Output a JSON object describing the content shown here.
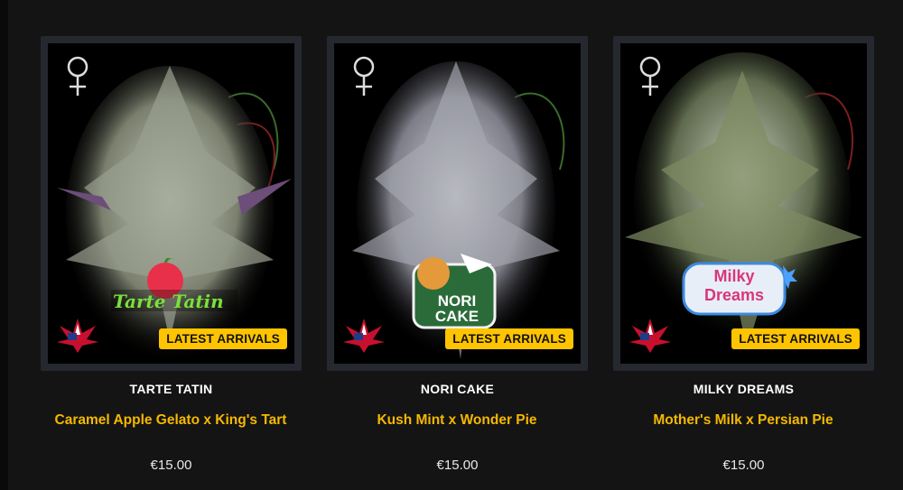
{
  "products": [
    {
      "name": "TARTE TATIN",
      "lineage": "Caramel Apple Gelato x King's Tart",
      "price": "€15.00",
      "badge": "LATEST ARRIVALS",
      "logo_text": "Tarte Tatin",
      "sex_icon": "female-symbol-icon",
      "flag_icon": "usa-flag-leaf-icon",
      "plant_color": "#a9b2a0"
    },
    {
      "name": "NORI CAKE",
      "lineage": "Kush Mint x Wonder Pie",
      "price": "€15.00",
      "badge": "LATEST ARRIVALS",
      "logo_text": "NORI CAKE",
      "sex_icon": "female-symbol-icon",
      "flag_icon": "usa-flag-leaf-icon",
      "plant_color": "#b7b8bf"
    },
    {
      "name": "MILKY DREAMS",
      "lineage": "Mother's Milk x Persian Pie",
      "price": "€15.00",
      "badge": "LATEST ARRIVALS",
      "logo_text": "Milky Dreams",
      "sex_icon": "female-symbol-icon",
      "flag_icon": "usa-flag-leaf-icon",
      "plant_color": "#8f9a7a"
    }
  ],
  "colors": {
    "background": "#141414",
    "card": "#262830",
    "badge": "#ffc400",
    "lineage": "#f5b800"
  }
}
